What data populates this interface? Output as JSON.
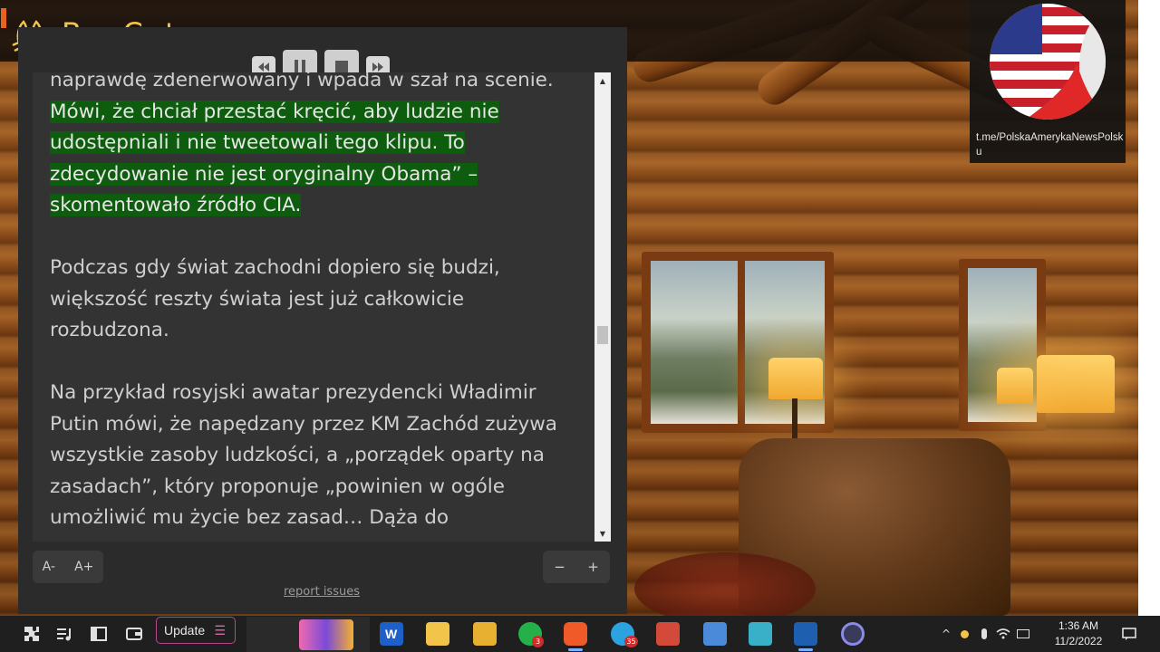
{
  "app": {
    "name": "BeeCut"
  },
  "media_controls": {
    "rewind_icon": "rewind-icon",
    "pause_icon": "pause-icon",
    "stop_icon": "stop-icon",
    "forward_icon": "fast-forward-icon"
  },
  "reader": {
    "paragraphs": [
      {
        "cut_line": "naprawdę zdenerwowany i wpada w szał na scenie.",
        "highlight": "Mówi, że chciał przestać kręcić, aby ludzie nie udostępniali i nie tweetowali tego klipu. To zdecydowanie nie jest oryginalny Obama” – skomentowało źródło CIA."
      },
      {
        "text": "Podczas gdy świat zachodni dopiero się budzi, większość reszty świata jest już całkowicie rozbudzona."
      },
      {
        "text": "Na przykład rosyjski awatar prezydencki Władimir Putin mówi, że napędzany przez KM Zachód zużywa wszystkie zasoby ludzkości, a „porządek oparty na zasadach”, który proponuje „powinien w ogóle umożliwić mu życie bez zasad… Dąża do"
      }
    ],
    "font_decrease": "A-",
    "font_increase": "A+",
    "zoom_out": "−",
    "zoom_in": "+",
    "report_link": "report issues"
  },
  "channel": {
    "text": "t.me/PolskaAmerykaNewsPolsku"
  },
  "taskbar": {
    "update_label": "Update",
    "update_menu_icon": "☰",
    "whatsapp_badge": "3",
    "telegram_badge": "35",
    "clock_time": "1:36 AM",
    "clock_date": "11/2/2022"
  }
}
